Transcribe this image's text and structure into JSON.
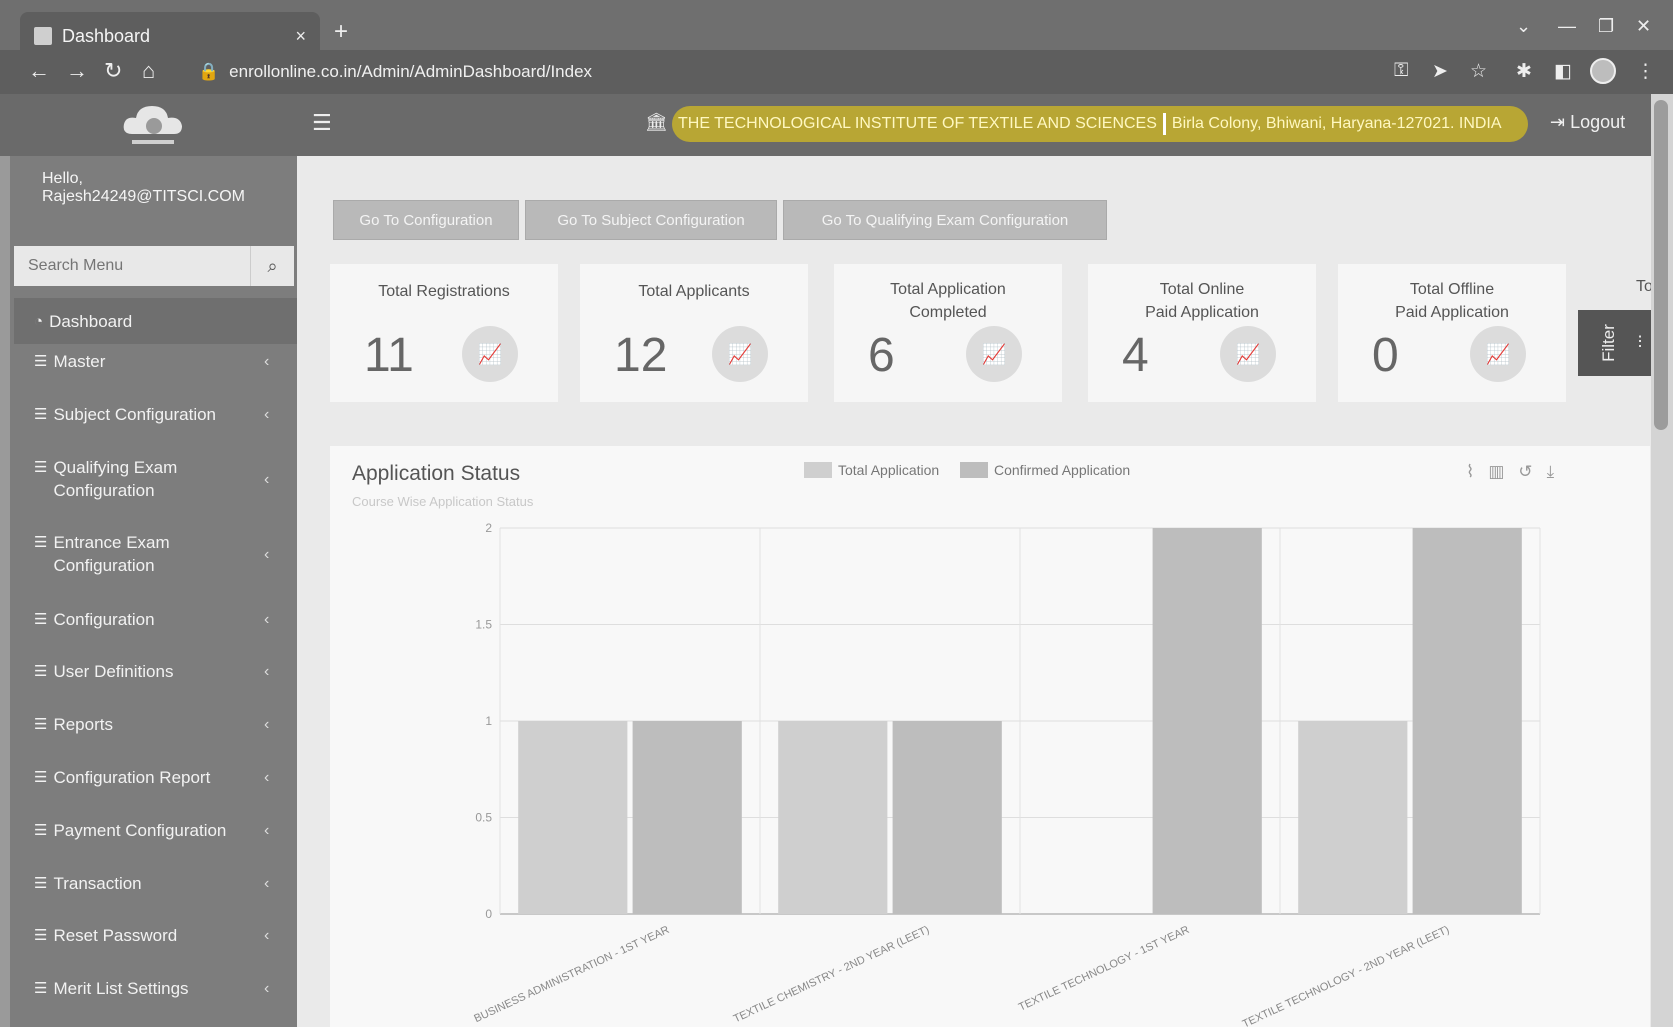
{
  "browser": {
    "tab_title": "Dashboard",
    "tab_close": "×",
    "new_tab": "+",
    "url": "enrollonline.co.in/Admin/AdminDashboard/Index"
  },
  "header": {
    "institute": "THE TECHNOLOGICAL INSTITUTE OF TEXTILE AND SCIENCES",
    "address": "Birla Colony, Bhiwani, Haryana-127021. INDIA",
    "logout": "Logout"
  },
  "user": {
    "greeting": "Hello,",
    "email": "Rajesh24249@TITSCI.COM"
  },
  "search": {
    "placeholder": "Search Menu"
  },
  "menu": [
    {
      "label": "Dashboard",
      "line2": ""
    },
    {
      "label": "Master",
      "line2": ""
    },
    {
      "label": "Subject Configuration",
      "line2": ""
    },
    {
      "label": "Qualifying Exam",
      "line2": "Configuration"
    },
    {
      "label": "Entrance Exam",
      "line2": "Configuration"
    },
    {
      "label": "Configuration",
      "line2": ""
    },
    {
      "label": "User Definitions",
      "line2": ""
    },
    {
      "label": "Reports",
      "line2": ""
    },
    {
      "label": "Configuration Report",
      "line2": ""
    },
    {
      "label": "Payment Configuration",
      "line2": ""
    },
    {
      "label": "Transaction",
      "line2": ""
    },
    {
      "label": "Reset Password",
      "line2": ""
    },
    {
      "label": "Merit List Settings",
      "line2": ""
    }
  ],
  "config_buttons": [
    "Go To Configuration",
    "Go To Subject Configuration",
    "Go To Qualifying Exam Configuration"
  ],
  "cards": [
    {
      "title": "Total Registrations",
      "title2": "",
      "value": "11"
    },
    {
      "title": "Total Applicants",
      "title2": "",
      "value": "12"
    },
    {
      "title": "Total Application",
      "title2": "Completed",
      "value": "6"
    },
    {
      "title": "Total Online",
      "title2": "Paid Application",
      "value": "4"
    },
    {
      "title": "Total Offline",
      "title2": "Paid Application",
      "value": "0"
    }
  ],
  "card_partial": "To",
  "filter": {
    "label": "Filter"
  },
  "chart_title": "Application Status",
  "chart_subtitle": "Course Wise Application Status",
  "colors": {
    "total": "#cfcfcf",
    "confirmed": "#bdbdbd",
    "banner": "#b8a634"
  },
  "chart_data": {
    "type": "bar",
    "title": "Application Status",
    "subtitle": "Course Wise Application Status",
    "categories": [
      "BUSINESS ADMINISTRATION - 1ST YEAR",
      "TEXTILE CHEMISTRY - 2ND YEAR (LEET)",
      "TEXTILE TECHNOLOGY - 1ST YEAR",
      "TEXTILE TECHNOLOGY - 2ND YEAR (LEET)"
    ],
    "series": [
      {
        "name": "Total Application",
        "values": [
          1,
          1,
          0,
          1
        ]
      },
      {
        "name": "Confirmed Application",
        "values": [
          1,
          1,
          2,
          2
        ]
      }
    ],
    "y_ticks": [
      "0",
      "0.5",
      "1",
      "1.5",
      "2"
    ],
    "ylim": [
      0,
      2
    ],
    "legend": "top-center",
    "grid": true
  }
}
